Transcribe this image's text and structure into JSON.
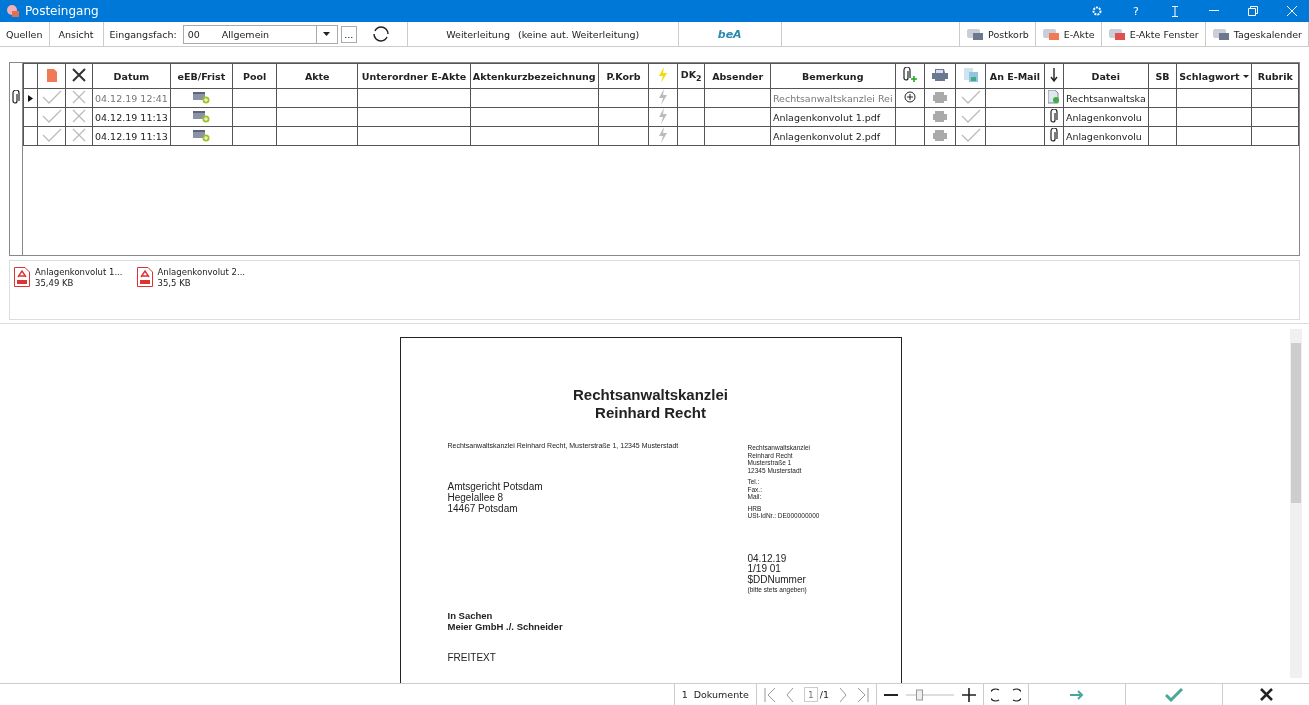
{
  "window": {
    "title": "Posteingang",
    "help": "?"
  },
  "toolbar": {
    "sources": "Quellen",
    "view": "Ansicht",
    "inbox_label": "Eingangsfach:",
    "inbox_code": "00",
    "inbox_name": "Allgemein",
    "more": "...",
    "forwarding": "Weiterleitung",
    "forwarding_state": "(keine aut. Weiterleitung)",
    "bea": "beA",
    "right_buttons": [
      {
        "label": "Postkorb"
      },
      {
        "label": "E-Akte"
      },
      {
        "label": "E-Akte Fenster"
      },
      {
        "label": "Tageskalender"
      }
    ]
  },
  "table": {
    "columns": [
      {
        "kind": "icon"
      },
      {
        "kind": "icon"
      },
      {
        "kind": "text",
        "label": "Datum"
      },
      {
        "kind": "text",
        "label": "eEB/Frist"
      },
      {
        "kind": "text",
        "label": "Pool"
      },
      {
        "kind": "text",
        "label": "Akte"
      },
      {
        "kind": "text",
        "label": "Unterordner E-Akte"
      },
      {
        "kind": "text",
        "label": "Aktenkurzbezeichnung"
      },
      {
        "kind": "text",
        "label": "P.Korb"
      },
      {
        "kind": "icon"
      },
      {
        "kind": "text",
        "label": "DK$_{2}$"
      },
      {
        "kind": "text",
        "label": "Absender"
      },
      {
        "kind": "text",
        "label": "Bemerkung"
      },
      {
        "kind": "icon"
      },
      {
        "kind": "icon"
      },
      {
        "kind": "icon"
      },
      {
        "kind": "text",
        "label": "An E-Mail"
      },
      {
        "kind": "icon"
      },
      {
        "kind": "text",
        "label": "Datei"
      },
      {
        "kind": "text",
        "label": "SB"
      },
      {
        "kind": "dropdown",
        "label": "Schlagwort"
      },
      {
        "kind": "text",
        "label": "Rubrik"
      }
    ],
    "rows": [
      {
        "selected": true,
        "attachment": true,
        "datum": "04.12.19 12:41",
        "bemerkung": "Rechtsanwaltskanzlei Rei",
        "add_attachment": true,
        "kind": "document",
        "datei": "Rechtsanwaltska"
      },
      {
        "selected": false,
        "attachment": false,
        "datum": "04.12.19 11:13",
        "bemerkung": "Anlagenkonvolut 1.pdf",
        "add_attachment": false,
        "kind": "clip",
        "datei": "Anlagenkonvolu"
      },
      {
        "selected": false,
        "attachment": false,
        "datum": "04.12.19 11:13",
        "bemerkung": "Anlagenkonvolut 2.pdf",
        "add_attachment": false,
        "kind": "clip",
        "datei": "Anlagenkonvolu"
      }
    ]
  },
  "attachments": [
    {
      "name": "Anlagenkonvolut 1...",
      "size": "35,49 KB"
    },
    {
      "name": "Anlagenkonvolut 2...",
      "size": "35,5 KB"
    }
  ],
  "document": {
    "heading": [
      "Rechtsanwaltskanzlei",
      "Reinhard Recht"
    ],
    "sender_line": "Rechtsanwaltskanzlei Reinhard Recht, Musterstraße 1, 12345 Musterstadt",
    "recipient": [
      "Amtsgericht Potsdam",
      "Hegelallee 8",
      "14467 Potsdam"
    ],
    "sidebar": [
      [
        "Rechtsanwaltskanzlei",
        "Reinhard Recht",
        "Musterstraße 1",
        "12345 Musterstadt"
      ],
      [
        "Tel.:",
        "Fax.:",
        "Mail:"
      ],
      [
        "HRB",
        "USt-IdNr.: DE000000000"
      ]
    ],
    "reference": [
      "04.12.19",
      "1/19 01",
      "$DDNummer"
    ],
    "reference_note": "(bitte stets angeben)",
    "subject": [
      "In Sachen",
      "Meier GmbH ./. Schneider"
    ],
    "body": "FREITEXT"
  },
  "status_bar": {
    "count": "1",
    "count_label": "Dokumente",
    "page": "1",
    "page_total": "/1",
    "zoom": {
      "level": 0.25
    }
  }
}
